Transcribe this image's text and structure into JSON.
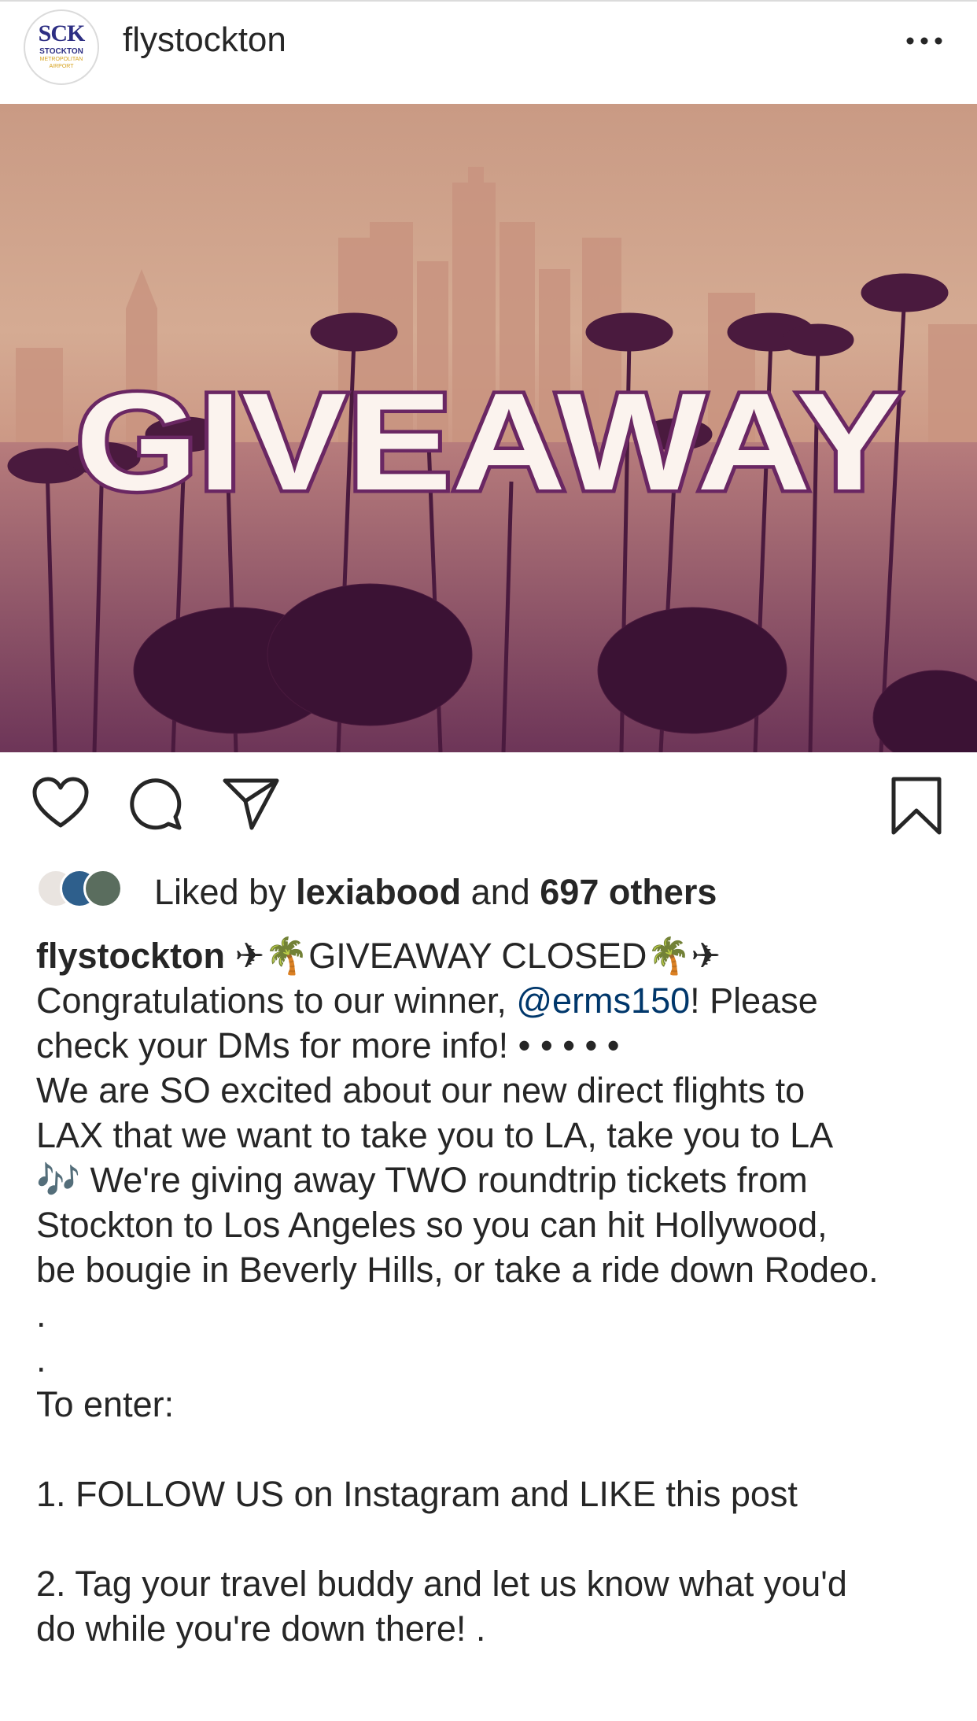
{
  "header": {
    "username": "flystockton",
    "avatar": {
      "line1": "SCK",
      "line2": "STOCKTON",
      "line3": "METROPOLITAN",
      "line4": "AIRPORT"
    },
    "more_icon": "more-horizontal-icon"
  },
  "post_image": {
    "headline": "GIVEAWAY"
  },
  "actions": {
    "like_icon": "heart-icon",
    "comment_icon": "comment-icon",
    "share_icon": "paper-plane-icon",
    "save_icon": "bookmark-icon"
  },
  "likes": {
    "prefix": "Liked by ",
    "user": "lexiabood",
    "middle": " and ",
    "others": "697 others"
  },
  "caption": {
    "username": "flystockton",
    "line1_rest": " ✈🌴GIVEAWAY CLOSED🌴✈",
    "line2_pre": "Congratulations to our winner, ",
    "mention": "@erms150",
    "line2_post": "! Please",
    "line3": "check your DMs for more info! • • • • •",
    "line4": "We are SO excited about our new direct flights to",
    "line5": "LAX that we want to take you to LA, take you to LA",
    "line6": "🎶 We're giving away TWO roundtrip tickets from",
    "line7": "Stockton to Los Angeles so you can hit Hollywood,",
    "line8": "be bougie in Beverly Hills, or take a ride down Rodeo.",
    "line9": ".",
    "line10": ".",
    "line11": "To enter:",
    "line12": "1. FOLLOW US on Instagram and LIKE this post",
    "line13": "2. Tag your travel buddy and let us know what you'd",
    "line14": "do while you're down there! ."
  },
  "colors": {
    "mention": "#00376b",
    "text": "#262626",
    "giveaway_outline": "#6a2763"
  }
}
